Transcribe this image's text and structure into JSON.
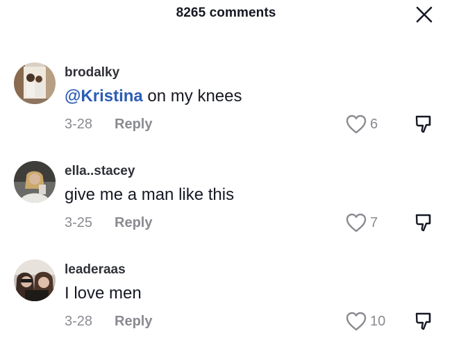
{
  "header": {
    "title": "8265 comments"
  },
  "comments": [
    {
      "username": "brodalky",
      "mention": "@Kristina",
      "text": " on my knees",
      "date": "3-28",
      "reply_label": "Reply",
      "likes": "6"
    },
    {
      "username": "ella..stacey",
      "text": "give me a man like this",
      "date": "3-25",
      "reply_label": "Reply",
      "likes": "7"
    },
    {
      "username": "leaderaas",
      "text": "I love men",
      "date": "3-28",
      "reply_label": "Reply",
      "likes": "10"
    }
  ],
  "icons": {
    "close": "close-icon",
    "like": "heart-outline-icon",
    "dislike": "thumbs-down-icon"
  },
  "colors": {
    "mention": "#2b5db5",
    "muted": "#8a8b91",
    "text": "#161823"
  }
}
